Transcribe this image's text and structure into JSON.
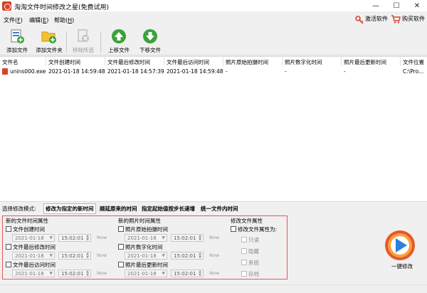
{
  "window": {
    "title": "淘淘文件时间修改之星(免费试用)",
    "minimize": "—",
    "maximize": "☐",
    "close": "✕"
  },
  "menu": {
    "file": "文件(",
    "file_key": "F",
    "edit": "编辑(",
    "edit_key": "E",
    "help": "帮助(",
    "help_key": "H",
    "close_paren": ")"
  },
  "top_links": {
    "activate": "激活软件",
    "buy": "购买软件"
  },
  "toolbar": {
    "add_file": "添加文件",
    "add_folder": "添加文件夹",
    "remove_selected": "移除所选",
    "move_up": "上移文件",
    "move_down": "下移文件"
  },
  "table": {
    "columns": [
      "文件名",
      "文件创建时间",
      "文件最后修改时间",
      "文件最后访问时间",
      "照片原始拍摄时间",
      "照片数字化时间",
      "照片最后更新时间",
      "文件位置"
    ],
    "rows": [
      {
        "name": "unins000.exe",
        "created": "2021-01-18 14:59:48",
        "modified": "2021-01-18 14:57:39",
        "accessed": "2021-01-18 14:59:48",
        "photo_taken": "-",
        "photo_digitized": "-",
        "photo_updated": "-",
        "location": "C:\\Pro..."
      }
    ]
  },
  "mode": {
    "label": "选择修改模式:",
    "options": [
      "修改为指定的新时间",
      "顺延原来的时间",
      "指定起始值按步长递增",
      "统一文件内时间"
    ],
    "selected": 0
  },
  "new_file_time": {
    "title": "新的文件时间属性",
    "items": [
      {
        "label": "文件创建时间",
        "date": "2021-01-18",
        "time": "15:02:01",
        "now": "Now"
      },
      {
        "label": "文件最后修改时间",
        "date": "2021-01-18",
        "time": "15:02:01",
        "now": "Now"
      },
      {
        "label": "文件最后访问时间",
        "date": "2021-01-18",
        "time": "15:02:01",
        "now": "Now"
      }
    ]
  },
  "new_photo_time": {
    "title": "新的照片时间属性",
    "items": [
      {
        "label": "照片原始拍摄时间",
        "date": "2021-01-18",
        "time": "15:02:01",
        "now": "Now"
      },
      {
        "label": "照片数字化时间",
        "date": "2021-01-18",
        "time": "15:02:01",
        "now": "Now"
      },
      {
        "label": "照片最后更新时间",
        "date": "2021-01-18",
        "time": "15:02:01",
        "now": "Now"
      }
    ]
  },
  "file_attr": {
    "title": "修改文件属性",
    "main_label": "修改文件属性为:",
    "options": [
      "只读",
      "隐藏",
      "系统",
      "存档"
    ]
  },
  "apply": {
    "label": "一键修改"
  },
  "colors": {
    "accent_red": "#e35a5a",
    "green_arrow": "#3aa23a",
    "folder_yellow": "#f2c230",
    "big_button_orange": "#e8572a",
    "big_button_blue": "#2f7fe0"
  }
}
